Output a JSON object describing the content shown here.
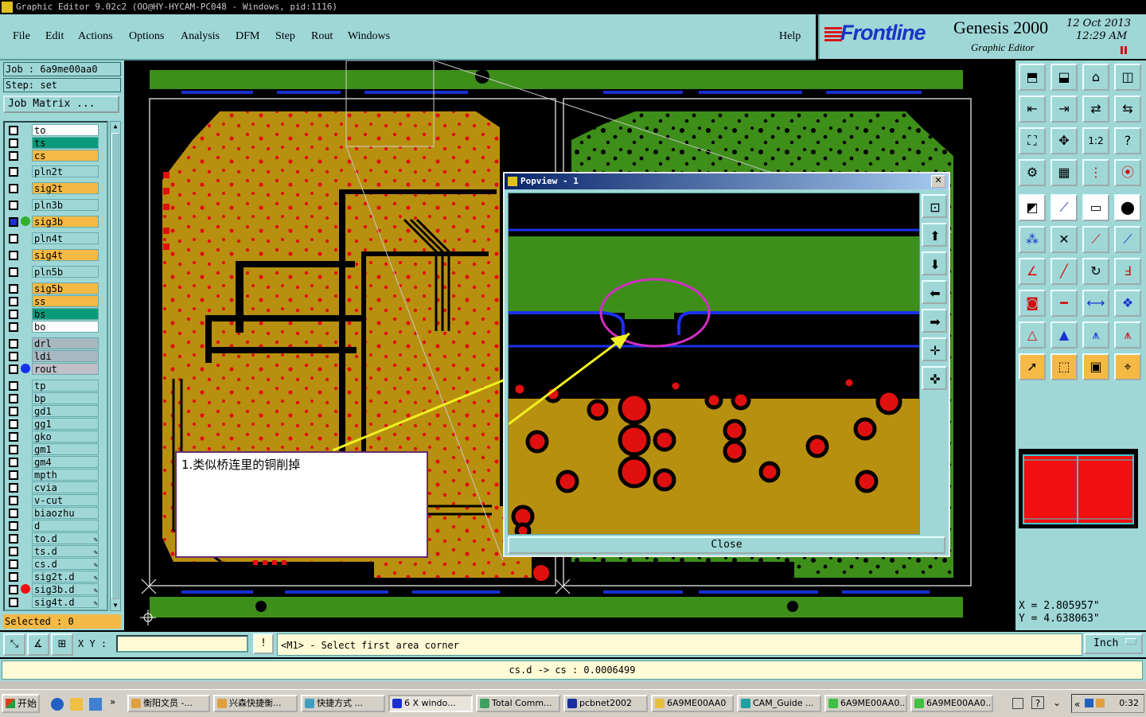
{
  "window": {
    "title": "Graphic Editor 9.02c2  (OO@HY-HYCAM-PC048 - Windows, pid:1116)"
  },
  "menu": {
    "items": [
      "File",
      "Edit",
      "Actions",
      "Options",
      "Analysis",
      "DFM",
      "Step",
      "Rout",
      "Windows"
    ],
    "help": "Help"
  },
  "brand": {
    "logo": "Frontline",
    "product": "Genesis 2000",
    "subtitle": "Graphic Editor",
    "date": "12  Oct  2013",
    "time": "12:29  AM"
  },
  "job": {
    "job_label": "Job  :  6a9me00aa0",
    "step_label": "Step:  set",
    "matrix_button": "Job Matrix ..."
  },
  "layers": [
    {
      "name": "to",
      "color": "#ffffff"
    },
    {
      "name": "ts",
      "color": "#0a9a7a"
    },
    {
      "name": "cs",
      "color": "#f5b945"
    },
    {
      "name": "pln2t",
      "color": "#9fd7d7"
    },
    {
      "name": "sig2t",
      "color": "#f5b945"
    },
    {
      "name": "pln3b",
      "color": "#9fd7d7"
    },
    {
      "name": "sig3b",
      "color": "#f5b945",
      "active": true
    },
    {
      "name": "pln4t",
      "color": "#9fd7d7"
    },
    {
      "name": "sig4t",
      "color": "#f5b945"
    },
    {
      "name": "pln5b",
      "color": "#9fd7d7"
    },
    {
      "name": "sig5b",
      "color": "#f5b945"
    },
    {
      "name": "ss",
      "color": "#f5b945"
    },
    {
      "name": "bs",
      "color": "#0a9a7a"
    },
    {
      "name": "bo",
      "color": "#ffffff"
    },
    {
      "name": "drl",
      "color": "#a8b8c0"
    },
    {
      "name": "ldi",
      "color": "#a8b8c0"
    },
    {
      "name": "rout",
      "color": "#c0c0c8"
    },
    {
      "name": "tp",
      "color": "#9fd7d7"
    },
    {
      "name": "bp",
      "color": "#9fd7d7"
    },
    {
      "name": "gd1",
      "color": "#9fd7d7"
    },
    {
      "name": "gg1",
      "color": "#9fd7d7"
    },
    {
      "name": "gko",
      "color": "#9fd7d7"
    },
    {
      "name": "gm1",
      "color": "#9fd7d7"
    },
    {
      "name": "gm4",
      "color": "#9fd7d7"
    },
    {
      "name": "mpth",
      "color": "#9fd7d7"
    },
    {
      "name": "cvia",
      "color": "#9fd7d7"
    },
    {
      "name": "v-cut",
      "color": "#9fd7d7"
    },
    {
      "name": "biaozhu",
      "color": "#9fd7d7"
    },
    {
      "name": "d",
      "color": "#9fd7d7"
    },
    {
      "name": "to.d",
      "color": "#9fd7d7"
    },
    {
      "name": "ts.d",
      "color": "#9fd7d7"
    },
    {
      "name": "cs.d",
      "color": "#9fd7d7"
    },
    {
      "name": "sig2t.d",
      "color": "#9fd7d7"
    },
    {
      "name": "sig3b.d",
      "color": "#9fd7d7"
    },
    {
      "name": "sig4t.d",
      "color": "#9fd7d7"
    }
  ],
  "selected_label": "Selected : 0",
  "coords": {
    "x": "X  =  2.805957\"",
    "y": "Y  =  4.638063\""
  },
  "popview": {
    "title": "Popview  -  1",
    "close_label": "Close"
  },
  "annotation": {
    "text": "1.类似桥连里的铜削掉"
  },
  "command": {
    "xy_label": "X Y :",
    "prompt": "<M1> - Select first area corner",
    "unit": "Inch"
  },
  "measure": {
    "text": "cs.d -> cs : 0.0006499"
  },
  "taskbar": {
    "start": "开始",
    "tasks": [
      "衡阳文员 -...",
      "兴森快捷衡...",
      "快捷方式 ...",
      "6 X windo...",
      "Total Comm...",
      "pcbnet2002",
      "6A9ME00AA0",
      "CAM_Guide ...",
      "6A9ME00AA0...",
      "6A9ME00AA0..."
    ],
    "clock": "0:32"
  }
}
